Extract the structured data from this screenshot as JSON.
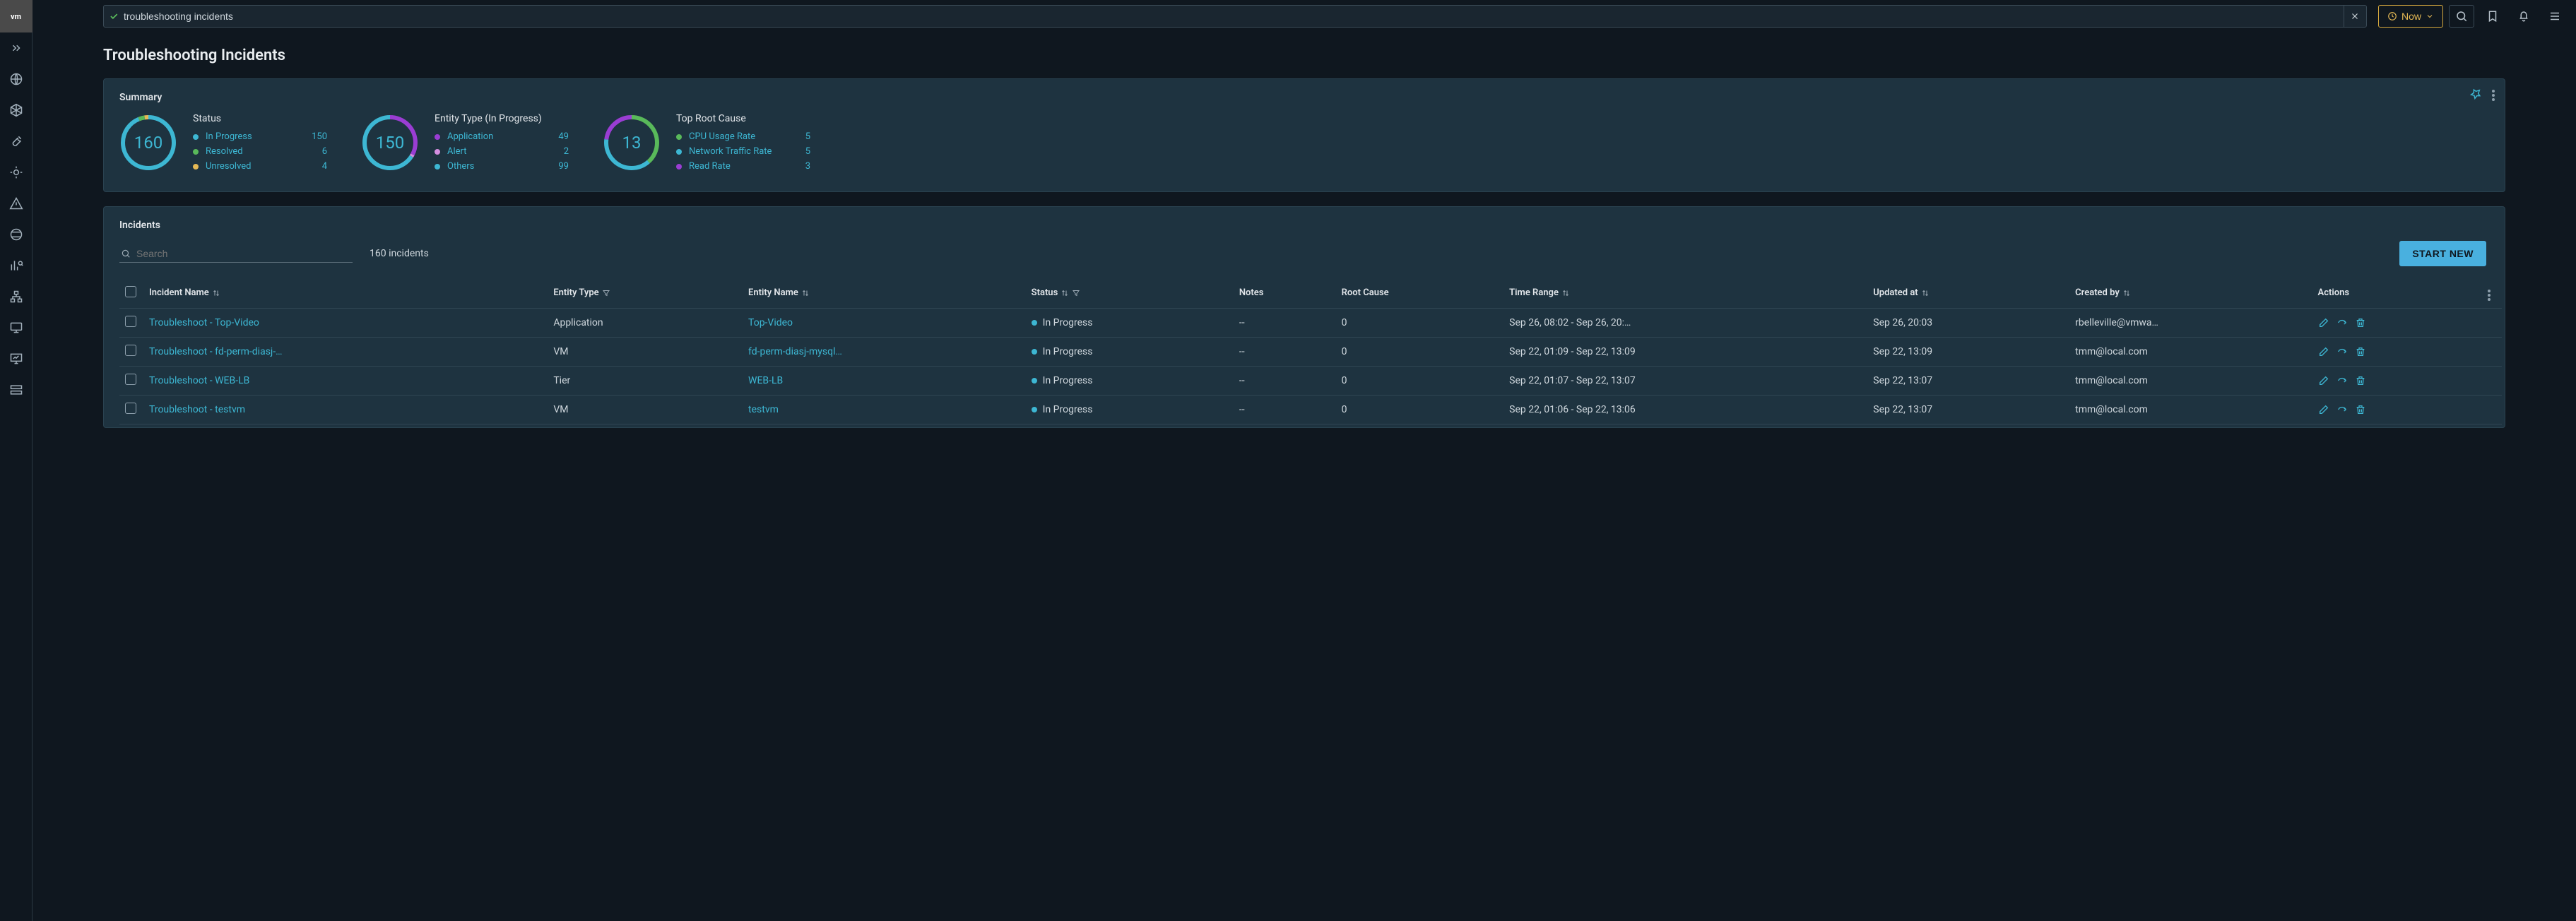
{
  "topbar": {
    "search_value": "troubleshooting incidents",
    "now_label": "Now"
  },
  "page": {
    "title": "Troubleshooting Incidents"
  },
  "summary": {
    "title": "Summary",
    "blocks": [
      {
        "center": "160",
        "title": "Status",
        "rows": [
          {
            "label": "In Progress",
            "value": "150",
            "color": "#3db7d3"
          },
          {
            "label": "Resolved",
            "value": "6",
            "color": "#59b95a"
          },
          {
            "label": "Unresolved",
            "value": "4",
            "color": "#e5b955"
          }
        ]
      },
      {
        "center": "150",
        "title": "Entity Type (In Progress)",
        "rows": [
          {
            "label": "Application",
            "value": "49",
            "color": "#9a3dd3"
          },
          {
            "label": "Alert",
            "value": "2",
            "color": "#d58ee0"
          },
          {
            "label": "Others",
            "value": "99",
            "color": "#3db7d3"
          }
        ]
      },
      {
        "center": "13",
        "title": "Top Root Cause",
        "rows": [
          {
            "label": "CPU Usage Rate",
            "value": "5",
            "color": "#59b95a"
          },
          {
            "label": "Network Traffic Rate",
            "value": "5",
            "color": "#3db7d3"
          },
          {
            "label": "Read Rate",
            "value": "3",
            "color": "#9a3dd3"
          }
        ]
      }
    ]
  },
  "incidents": {
    "title": "Incidents",
    "search_placeholder": "Search",
    "count_text": "160 incidents",
    "start_label": "START NEW",
    "headers": {
      "incident": "Incident Name",
      "entity_type": "Entity Type",
      "entity_name": "Entity Name",
      "status": "Status",
      "notes": "Notes",
      "root_cause": "Root Cause",
      "time_range": "Time Range",
      "updated": "Updated at",
      "created_by": "Created by",
      "actions": "Actions"
    },
    "rows": [
      {
        "name": "Troubleshoot - Top-Video",
        "entity_type": "Application",
        "entity_name": "Top-Video",
        "status": "In Progress",
        "notes": "--",
        "root_cause": "0",
        "time_range": "Sep 26, 08:02 - Sep 26, 20:…",
        "updated": "Sep 26, 20:03",
        "created_by": "rbelleville@vmwa…"
      },
      {
        "name": "Troubleshoot - fd-perm-diasj-…",
        "entity_type": "VM",
        "entity_name": "fd-perm-diasj-mysql…",
        "status": "In Progress",
        "notes": "--",
        "root_cause": "0",
        "time_range": "Sep 22, 01:09 - Sep 22, 13:09",
        "updated": "Sep 22, 13:09",
        "created_by": "tmm@local.com"
      },
      {
        "name": "Troubleshoot - WEB-LB",
        "entity_type": "Tier",
        "entity_name": "WEB-LB",
        "status": "In Progress",
        "notes": "--",
        "root_cause": "0",
        "time_range": "Sep 22, 01:07 - Sep 22, 13:07",
        "updated": "Sep 22, 13:07",
        "created_by": "tmm@local.com"
      },
      {
        "name": "Troubleshoot - testvm",
        "entity_type": "VM",
        "entity_name": "testvm",
        "status": "In Progress",
        "notes": "--",
        "root_cause": "0",
        "time_range": "Sep 22, 01:06 - Sep 22, 13:06",
        "updated": "Sep 22, 13:07",
        "created_by": "tmm@local.com"
      }
    ]
  },
  "chart_data": [
    {
      "type": "pie",
      "title": "Status",
      "categories": [
        "In Progress",
        "Resolved",
        "Unresolved"
      ],
      "values": [
        150,
        6,
        4
      ],
      "colors": [
        "#3db7d3",
        "#59b95a",
        "#e5b955"
      ],
      "total": 160
    },
    {
      "type": "pie",
      "title": "Entity Type (In Progress)",
      "categories": [
        "Application",
        "Alert",
        "Others"
      ],
      "values": [
        49,
        2,
        99
      ],
      "colors": [
        "#9a3dd3",
        "#d58ee0",
        "#3db7d3"
      ],
      "total": 150
    },
    {
      "type": "pie",
      "title": "Top Root Cause",
      "categories": [
        "CPU Usage Rate",
        "Network Traffic Rate",
        "Read Rate"
      ],
      "values": [
        5,
        5,
        3
      ],
      "colors": [
        "#59b95a",
        "#3db7d3",
        "#9a3dd3"
      ],
      "total": 13
    }
  ]
}
